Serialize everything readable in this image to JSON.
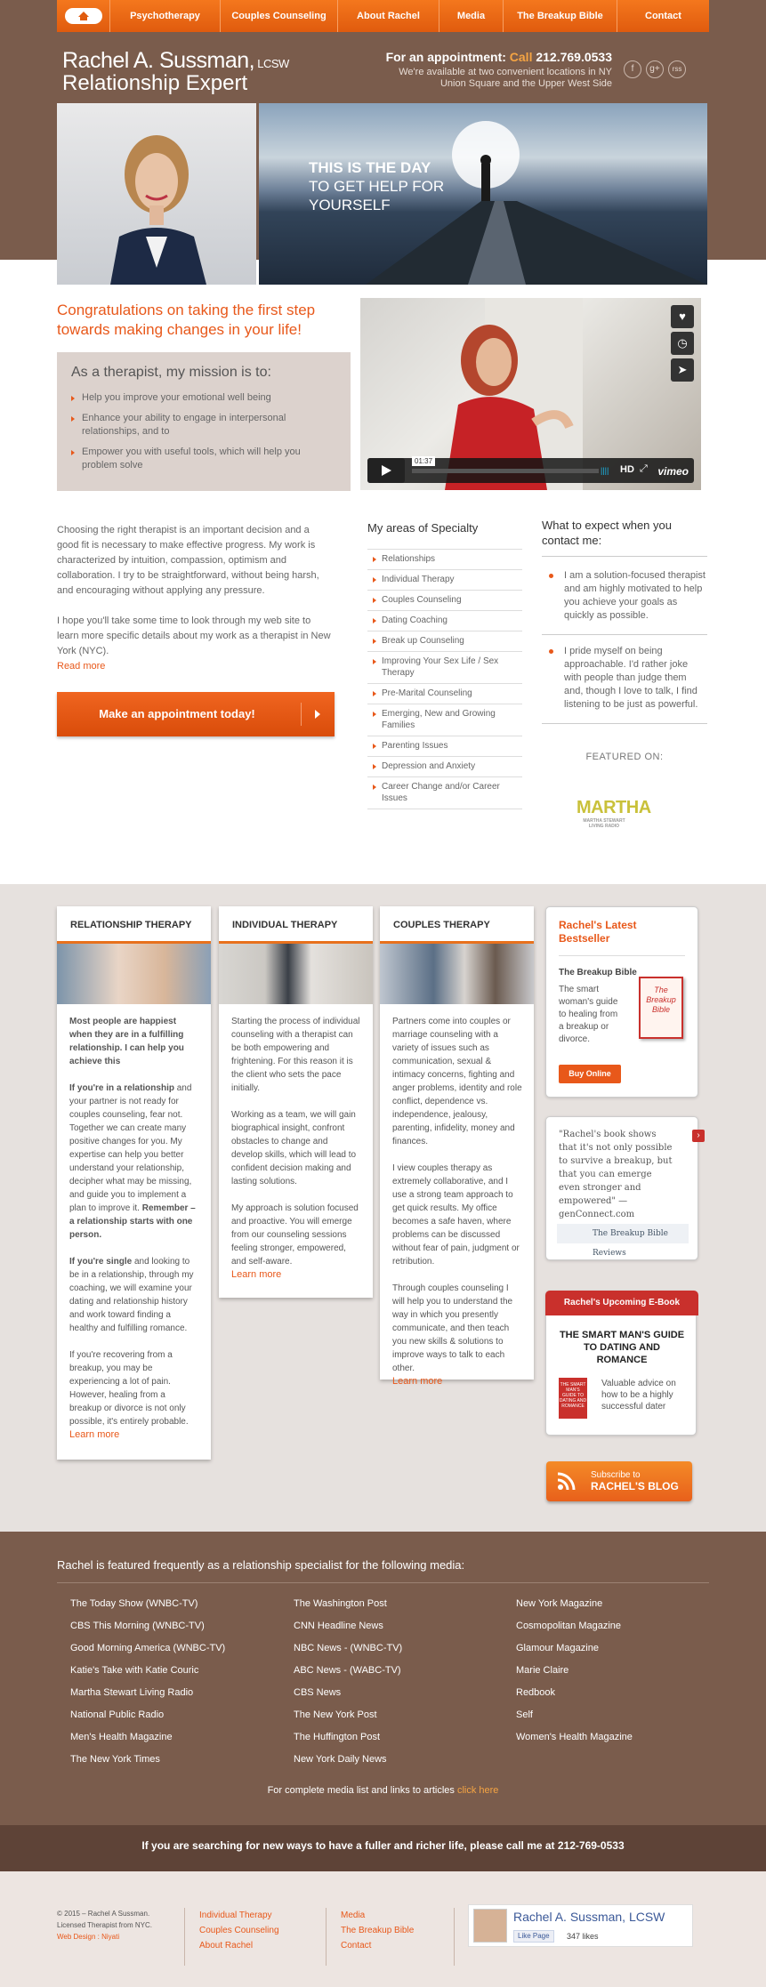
{
  "nav": {
    "home_label": "",
    "items": [
      "Psychotherapy",
      "Couples Counseling",
      "About Rachel",
      "Media",
      "The Breakup Bible",
      "Contact"
    ]
  },
  "brand": {
    "name": "Rachel A. Sussman,",
    "cred": " LCSW",
    "tagline": "Relationship Expert"
  },
  "appointment": {
    "prefix": "For an appointment: ",
    "call": "Call",
    "phone": "212.769.0533",
    "locations": "We're available at two convenient locations in NY Union Square and the Upper West Side"
  },
  "social": [
    "f",
    "g+",
    "rss"
  ],
  "hero": {
    "line1": "THIS IS THE DAY",
    "line2": "TO GET HELP FOR",
    "line3": "YOURSELF"
  },
  "intro": {
    "congrats": "Congratulations on taking the first step towards making changes in your life!",
    "mission_title": "As a therapist, my mission is to:",
    "mission_items": [
      "Help you improve your emotional well being",
      "Enhance your ability to engage in interpersonal relationships, and to",
      "Empower you with useful tools, which will help you problem solve"
    ]
  },
  "video": {
    "time": "01:37",
    "hd": "HD",
    "brand": "vimeo",
    "icons": [
      "heart-icon",
      "clock-icon",
      "send-icon"
    ]
  },
  "lead": {
    "p1": "Choosing the right therapist is an important decision and a good fit is necessary to make effective progress. My work is characterized by intuition, compassion, optimism and collaboration. I try to be straightforward, without being harsh, and encouraging without applying any pressure.",
    "p2": "I hope you'll take some time to look through my web site to learn more specific details about my work as a therapist in New York (NYC).",
    "read_more": "Read more",
    "cta": "Make an appointment today!"
  },
  "specialty": {
    "title": "My areas of Specialty",
    "items": [
      "Relationships",
      "Individual Therapy",
      "Couples Counseling",
      "Dating Coaching",
      "Break up Counseling",
      "Improving Your Sex Life / Sex Therapy",
      "Pre-Marital Counseling",
      "Emerging, New and Growing Families",
      "Parenting Issues",
      "Depression and Anxiety",
      "Career Change and/or Career Issues"
    ]
  },
  "expect": {
    "title": "What to expect when you contact me:",
    "items": [
      "I am a solution-focused therapist and am highly motivated to help you achieve your goals as quickly as possible.",
      "I pride myself on being approachable. I'd rather joke with people than judge them and, though I love to talk, I find listening to be just as powerful."
    ],
    "featured": "FEATURED ON:",
    "martha": "MARTHA",
    "martha_sub": "MARTHA STEWART LIVING RADIO"
  },
  "cards": {
    "relationship": {
      "title": "RELATIONSHIP THERAPY",
      "p1_bold": "Most people are happiest when they are in a fulfilling relationship. I can help you achieve this",
      "p2_bold": "If you're in a relationship",
      "p2": " and your partner is not ready for couples counseling, fear not. Together we can create many positive changes for you. My expertise can help you better understand your relationship, decipher what may be missing, and guide you to implement a plan to improve it. ",
      "p2_bold2": "Remember – a relationship starts with one person.",
      "p3_bold": "If you're single",
      "p3": " and looking to be in a relationship, through my coaching, we will examine your dating and relationship history and work toward finding a healthy and fulfilling romance.",
      "p4": "If you're recovering from a breakup, you may be experiencing a lot of pain. However, healing from a breakup or divorce is not only possible, it's entirely probable.",
      "more": "Learn more"
    },
    "individual": {
      "title": "INDIVIDUAL THERAPY",
      "p1": "Starting the process of individual counseling with a therapist can be both empowering and frightening. For this reason it is the client who sets the pace initially.",
      "p2": "Working as a team, we will gain biographical insight, confront obstacles to change and develop skills, which will lead to confident decision making and lasting solutions.",
      "p3": "My approach is solution focused and proactive. You will emerge from our counseling sessions feeling stronger, empowered, and self-aware.",
      "more": "Learn more"
    },
    "couples": {
      "title": "COUPLES THERAPY",
      "p1": "Partners come into couples or marriage counseling with a variety of issues such as communication, sexual & intimacy concerns, fighting and anger problems, identity and role conflict, dependence vs. independence, jealousy, parenting, infidelity, money and finances.",
      "p2": "I view couples therapy as extremely collaborative, and I use a strong team approach to get quick results. My office becomes a safe haven, where problems can be discussed without fear of pain, judgment or retribution.",
      "p3": "Through couples counseling I will help you to understand the way in which you presently communicate, and then teach you new skills & solutions to improve ways to talk to each other.",
      "more": "Learn more"
    }
  },
  "bestseller": {
    "title": "Rachel's Latest Bestseller",
    "book": "The Breakup Bible",
    "desc": "The smart woman's guide to healing from a breakup or divorce.",
    "cover": "The Breakup Bible",
    "buy": "Buy Online"
  },
  "quote": {
    "text": "\"Rachel's book shows that it's not only possible to survive a breakup, but that you can emerge even stronger and empowered\" — genConnect.com",
    "reviews": "The Breakup Bible Reviews"
  },
  "ebook": {
    "header": "Rachel's Upcoming E-Book",
    "title": "THE SMART MAN'S GUIDE TO DATING AND ROMANCE",
    "desc": "Valuable advice on how to be a highly successful dater"
  },
  "blog": {
    "line1": "Subscribe to",
    "line2": "RACHEL'S BLOG"
  },
  "media": {
    "title": "Rachel is featured frequently as a relationship specialist for the following media:",
    "col1": [
      "The Today Show (WNBC-TV)",
      "CBS This Morning  (WNBC-TV)",
      "Good Morning America  (WNBC-TV)",
      "Katie's Take with Katie Couric",
      "Martha Stewart Living Radio",
      "National Public Radio",
      "Men's Health Magazine",
      "The New York Times"
    ],
    "col2": [
      "The Washington Post",
      "CNN Headline News",
      "NBC News - (WNBC-TV)",
      "ABC News - (WABC-TV)",
      "CBS News",
      "The New York Post",
      "The Huffington Post",
      "New York Daily News"
    ],
    "col3": [
      "New York Magazine",
      "Cosmopolitan Magazine",
      "Glamour Magazine",
      "Marie Claire",
      "Redbook",
      "Self",
      "Women's Health Magazine"
    ],
    "more_prefix": "For complete media list and links to articles ",
    "more_link": "click here"
  },
  "callout": {
    "text": "If you are searching for new ways to have a fuller and richer life, please ",
    "link": "call me at 212-769-0533"
  },
  "footer": {
    "copy1": "© 2015 – Rachel A Sussman.",
    "copy2": "Licensed Therapist from NYC.",
    "design": "Web Design : Niyati",
    "col1": [
      "Individual Therapy",
      "Couples Counseling",
      "About Rachel"
    ],
    "col2": [
      "Media",
      "The Breakup Bible",
      "Contact"
    ],
    "fb_name": "Rachel A. Sussman, LCSW",
    "fb_like": "Like Page",
    "fb_count": "347 likes"
  },
  "colors": {
    "accent": "#e8581a",
    "brown": "#7a5c4c",
    "dark_brown": "#5e4337",
    "ebook_red": "#c9302c"
  }
}
